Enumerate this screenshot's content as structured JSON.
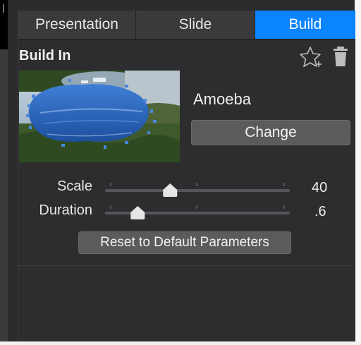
{
  "tabs": [
    {
      "label": "Presentation",
      "active": false
    },
    {
      "label": "Slide",
      "active": false
    },
    {
      "label": "Build",
      "active": true
    }
  ],
  "section": {
    "title": "Build In"
  },
  "icons": {
    "favorite": "star-plus-icon",
    "delete": "trash-icon"
  },
  "effect": {
    "name": "Amoeba",
    "change_label": "Change"
  },
  "parameters": {
    "scale": {
      "label": "Scale",
      "value": "40",
      "fraction": 0.34
    },
    "duration": {
      "label": "Duration",
      "value": ".6",
      "fraction": 0.15
    }
  },
  "reset_label": "Reset to Default Parameters",
  "colors": {
    "accent": "#0a84ff",
    "panel_bg": "#2d2d2f",
    "button_bg": "#5b5b5e"
  }
}
